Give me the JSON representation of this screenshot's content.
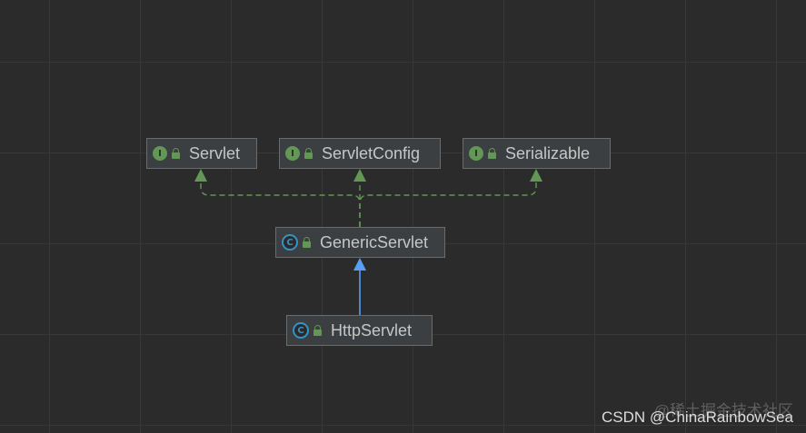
{
  "diagram": {
    "nodes": [
      {
        "id": "servlet",
        "label": "Servlet",
        "kind": "interface",
        "icon": "interface-icon",
        "kind_glyph": "I"
      },
      {
        "id": "servletconfig",
        "label": "ServletConfig",
        "kind": "interface",
        "icon": "interface-icon",
        "kind_glyph": "I"
      },
      {
        "id": "serializable",
        "label": "Serializable",
        "kind": "interface",
        "icon": "interface-icon",
        "kind_glyph": "I"
      },
      {
        "id": "genericservlet",
        "label": "GenericServlet",
        "kind": "abstract-class",
        "icon": "class-icon",
        "kind_glyph": "C"
      },
      {
        "id": "httpservlet",
        "label": "HttpServlet",
        "kind": "abstract-class",
        "icon": "class-icon",
        "kind_glyph": "C"
      }
    ],
    "edges": [
      {
        "from": "genericservlet",
        "to": "servlet",
        "type": "implements"
      },
      {
        "from": "genericservlet",
        "to": "servletconfig",
        "type": "implements"
      },
      {
        "from": "genericservlet",
        "to": "serializable",
        "type": "implements"
      },
      {
        "from": "httpservlet",
        "to": "genericservlet",
        "type": "extends"
      }
    ],
    "colors": {
      "implements": "#629755",
      "extends": "#589df6",
      "background": "#2b2b2b"
    }
  },
  "watermark": {
    "line1": "@稀土掘金技术社区",
    "line2": "CSDN @ChinaRainbowSea"
  }
}
